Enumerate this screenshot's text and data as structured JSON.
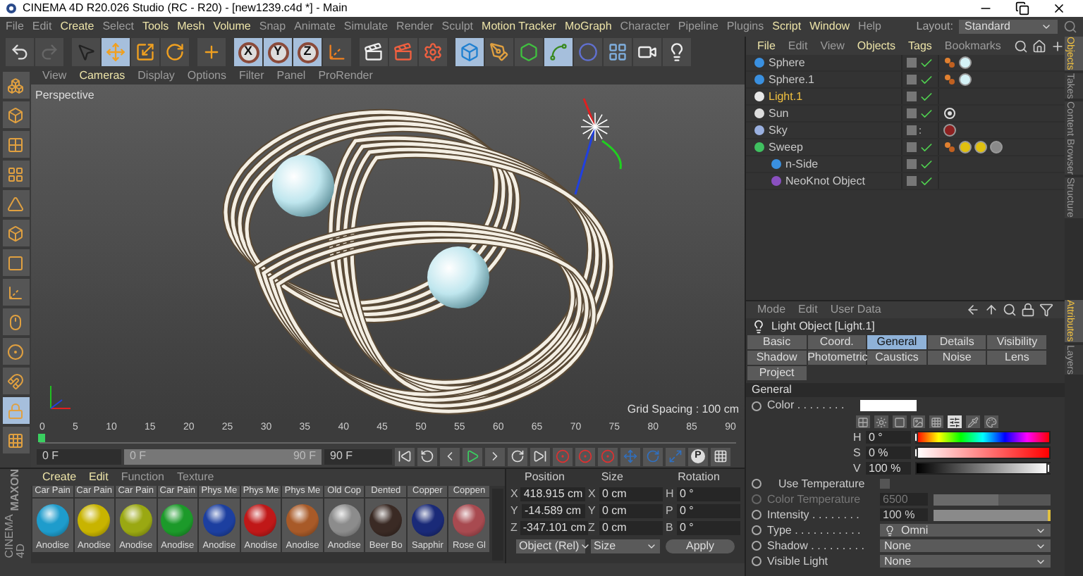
{
  "window": {
    "title": "CINEMA 4D R20.026 Studio (RC - R20) - [new1239.c4d *] - Main"
  },
  "menu": [
    {
      "label": "File",
      "highlight": false
    },
    {
      "label": "Edit",
      "highlight": false
    },
    {
      "label": "Create",
      "highlight": true
    },
    {
      "label": "Select",
      "highlight": false
    },
    {
      "label": "Tools",
      "highlight": true
    },
    {
      "label": "Mesh",
      "highlight": true
    },
    {
      "label": "Volume",
      "highlight": true
    },
    {
      "label": "Snap",
      "highlight": false
    },
    {
      "label": "Animate",
      "highlight": false
    },
    {
      "label": "Simulate",
      "highlight": false
    },
    {
      "label": "Render",
      "highlight": false
    },
    {
      "label": "Sculpt",
      "highlight": false
    },
    {
      "label": "Motion Tracker",
      "highlight": true
    },
    {
      "label": "MoGraph",
      "highlight": true
    },
    {
      "label": "Character",
      "highlight": false
    },
    {
      "label": "Pipeline",
      "highlight": false
    },
    {
      "label": "Plugins",
      "highlight": false
    },
    {
      "label": "Script",
      "highlight": true
    },
    {
      "label": "Window",
      "highlight": true
    },
    {
      "label": "Help",
      "highlight": false
    }
  ],
  "layout": {
    "label": "Layout:",
    "value": "Standard"
  },
  "toolbar": [
    {
      "kind": "undo",
      "active": false
    },
    {
      "kind": "redo",
      "active": false
    },
    {
      "kind": "separator"
    },
    {
      "kind": "select",
      "active": false
    },
    {
      "kind": "move",
      "active": true
    },
    {
      "kind": "scale",
      "active": false
    },
    {
      "kind": "rotate",
      "active": false
    },
    {
      "kind": "separator"
    },
    {
      "kind": "add",
      "active": false
    },
    {
      "kind": "separator"
    },
    {
      "kind": "axis",
      "label": "X",
      "active": true
    },
    {
      "kind": "axis",
      "label": "Y",
      "active": true
    },
    {
      "kind": "axis",
      "label": "Z",
      "active": true
    },
    {
      "kind": "coords",
      "active": false
    },
    {
      "kind": "separator"
    },
    {
      "kind": "render-view",
      "active": false
    },
    {
      "kind": "render",
      "active": false
    },
    {
      "kind": "render-settings",
      "active": false
    },
    {
      "kind": "separator"
    },
    {
      "kind": "cube",
      "active": true
    },
    {
      "kind": "pen",
      "active": false
    },
    {
      "kind": "subdivision",
      "active": false
    },
    {
      "kind": "sweep",
      "active": true
    },
    {
      "kind": "deformer",
      "active": false
    },
    {
      "kind": "floor",
      "active": false
    },
    {
      "kind": "camera",
      "active": false
    },
    {
      "kind": "light",
      "active": false
    }
  ],
  "tools": [
    {
      "kind": "convert",
      "active": false
    },
    {
      "kind": "model",
      "active": false
    },
    {
      "kind": "texture",
      "active": false
    },
    {
      "kind": "workplane",
      "active": false
    },
    {
      "kind": "points",
      "active": false
    },
    {
      "kind": "edges",
      "active": false
    },
    {
      "kind": "polygons",
      "active": false
    },
    {
      "kind": "axis",
      "active": false
    },
    {
      "kind": "tweak",
      "active": false
    },
    {
      "kind": "snap",
      "active": false
    },
    {
      "kind": "magnet",
      "active": false
    },
    {
      "kind": "lock",
      "active": true
    },
    {
      "kind": "planar",
      "active": false
    }
  ],
  "viewport": {
    "menu": [
      {
        "label": "View",
        "highlight": false
      },
      {
        "label": "Cameras",
        "highlight": true
      },
      {
        "label": "Display",
        "highlight": false
      },
      {
        "label": "Options",
        "highlight": false
      },
      {
        "label": "Filter",
        "highlight": false
      },
      {
        "label": "Panel",
        "highlight": false
      },
      {
        "label": "ProRender",
        "highlight": false
      }
    ],
    "camera": "Perspective",
    "grid_spacing": "Grid Spacing : 100 cm"
  },
  "timeline": {
    "ticks": [
      "0",
      "5",
      "10",
      "15",
      "20",
      "25",
      "30",
      "35",
      "40",
      "45",
      "50",
      "55",
      "60",
      "65",
      "70",
      "75",
      "80",
      "85",
      "90"
    ],
    "level": 0
  },
  "playback": {
    "start": "0 F",
    "range_start": "0 F",
    "range_end": "90 F",
    "level": 1,
    "end": "90 F",
    "buttons": [
      {
        "kind": "first"
      },
      {
        "kind": "prev-key"
      },
      {
        "kind": "prev-frame"
      },
      {
        "kind": "play"
      },
      {
        "kind": "next-frame"
      },
      {
        "kind": "next-key"
      },
      {
        "kind": "last"
      },
      {
        "kind": "record"
      },
      {
        "kind": "record"
      },
      {
        "kind": "record"
      },
      {
        "kind": "key-move"
      },
      {
        "kind": "key-rotate"
      },
      {
        "kind": "key-scale"
      },
      {
        "kind": "param",
        "label": "P"
      },
      {
        "kind": "grid"
      }
    ]
  },
  "logo": {
    "top": "MAXON",
    "bottom": "CINEMA 4D"
  },
  "materials": {
    "menu": [
      {
        "label": "Create",
        "highlight": true
      },
      {
        "label": "Edit",
        "highlight": true
      },
      {
        "label": "Function",
        "highlight": false
      },
      {
        "label": "Texture",
        "highlight": false
      }
    ],
    "upper_row_labels": [
      "Car Pain",
      "Car Pain",
      "Car Pain",
      "Car Pain",
      "Phys Me",
      "Phys Me",
      "Phys Me",
      "Old Cop",
      "Dented",
      "Copper",
      "Coppen"
    ],
    "items": [
      {
        "name": "Anodise",
        "color": "#1e9ccc"
      },
      {
        "name": "Anodise",
        "color": "#c8b400"
      },
      {
        "name": "Anodise",
        "color": "#9aa812"
      },
      {
        "name": "Anodise",
        "color": "#1c9a2a"
      },
      {
        "name": "Anodise",
        "color": "#1c3fa0"
      },
      {
        "name": "Anodise",
        "color": "#c01818"
      },
      {
        "name": "Anodise",
        "color": "#a85a28"
      },
      {
        "name": "Anodise",
        "color": "#8c8c8c"
      },
      {
        "name": "Beer Bo",
        "color": "#3a2a24"
      },
      {
        "name": "Sapphir",
        "color": "#1a2a78"
      },
      {
        "name": "Rose Gl",
        "color": "#a84a50"
      }
    ]
  },
  "coordinates": {
    "headers": [
      "Position",
      "Size",
      "Rotation"
    ],
    "rows": [
      [
        {
          "axis": "X",
          "value": "418.915 cm"
        },
        {
          "axis": "X",
          "value": "0 cm"
        },
        {
          "axis": "H",
          "value": "0 °"
        }
      ],
      [
        {
          "axis": "Y",
          "value": "-14.589 cm"
        },
        {
          "axis": "Y",
          "value": "0 cm"
        },
        {
          "axis": "P",
          "value": "0 °"
        }
      ],
      [
        {
          "axis": "Z",
          "value": "-347.101 cm"
        },
        {
          "axis": "Z",
          "value": "0 cm"
        },
        {
          "axis": "B",
          "value": "0 °"
        }
      ]
    ],
    "mode": "Object (Rel)",
    "size_mode": "Size",
    "apply": "Apply"
  },
  "objects": {
    "menu": [
      {
        "label": "File",
        "highlight": true
      },
      {
        "label": "Edit",
        "highlight": false
      },
      {
        "label": "View",
        "highlight": false
      },
      {
        "label": "Objects",
        "highlight": true
      },
      {
        "label": "Tags",
        "highlight": true
      },
      {
        "label": "Bookmarks",
        "highlight": false
      }
    ],
    "items": [
      {
        "name": "Sphere",
        "kind": "sphere",
        "selected": false,
        "enabled": true,
        "tags": [
          {
            "kind": "phong"
          },
          {
            "kind": "material",
            "color": "#d4f2f6"
          }
        ]
      },
      {
        "name": "Sphere.1",
        "kind": "sphere",
        "selected": false,
        "enabled": true,
        "tags": [
          {
            "kind": "phong"
          },
          {
            "kind": "material",
            "color": "#d4f2f6"
          }
        ]
      },
      {
        "name": "Light.1",
        "kind": "light",
        "selected": true,
        "enabled": true
      },
      {
        "name": "Sun",
        "kind": "sun",
        "selected": false,
        "enabled": true,
        "tags": [
          {
            "kind": "target"
          }
        ]
      },
      {
        "name": "Sky",
        "kind": "sky",
        "selected": false,
        "enabled": false,
        "tags": [
          {
            "kind": "material",
            "color": "#8c2020"
          }
        ]
      },
      {
        "name": "Sweep",
        "kind": "sweep",
        "selected": false,
        "enabled": true,
        "tags": [
          {
            "kind": "phong"
          },
          {
            "kind": "material",
            "color": "#e0c010"
          },
          {
            "kind": "material",
            "color": "#e0c010"
          },
          {
            "kind": "material",
            "color": "#8a8a8a"
          }
        ],
        "children": [
          {
            "name": "n-Side",
            "kind": "spline",
            "selected": false,
            "enabled": true
          },
          {
            "name": "NeoKnot Object",
            "kind": "knot",
            "selected": false,
            "enabled": true
          }
        ]
      }
    ]
  },
  "side_tabs_top": [
    {
      "label": "Objects",
      "selected": true
    },
    {
      "label": "Takes",
      "selected": false
    },
    {
      "label": "Content Browser",
      "selected": false
    },
    {
      "label": "Structure",
      "selected": false
    }
  ],
  "attributes": {
    "menu": [
      {
        "label": "Mode",
        "highlight": false
      },
      {
        "label": "Edit",
        "highlight": false
      },
      {
        "label": "User Data",
        "highlight": false
      }
    ],
    "title": "Light Object [Light.1]",
    "tabs": [
      {
        "label": "Basic",
        "selected": false
      },
      {
        "label": "Coord.",
        "selected": false
      },
      {
        "label": "General",
        "selected": true
      },
      {
        "label": "Details",
        "selected": false
      },
      {
        "label": "Visibility",
        "selected": false
      },
      {
        "label": "Shadow",
        "selected": false
      },
      {
        "label": "Photometric",
        "selected": false
      },
      {
        "label": "Caustics",
        "selected": false
      },
      {
        "label": "Noise",
        "selected": false
      },
      {
        "label": "Lens",
        "selected": false
      },
      {
        "label": "Project",
        "selected": false
      }
    ],
    "section": "General",
    "color": {
      "label": "Color . . . . . . . .",
      "color": "#ffffff",
      "modes": [
        {
          "selected": false
        },
        {
          "selected": false
        },
        {
          "selected": false
        },
        {
          "selected": false
        },
        {
          "selected": false
        },
        {
          "selected": true
        },
        {
          "selected": false
        },
        {
          "selected": false
        }
      ],
      "channels": [
        {
          "kind": "hue",
          "label": "H",
          "value": "0 °",
          "level": 0
        },
        {
          "kind": "saturation",
          "label": "S",
          "value": "0 %",
          "level": 0
        },
        {
          "kind": "value",
          "label": "V",
          "value": "100 %",
          "level": 1
        }
      ]
    },
    "fields": [
      {
        "kind": "checkbox",
        "label": "Use Temperature",
        "checked": false,
        "disabled": false
      },
      {
        "kind": "slider",
        "label": "Color Temperature",
        "value": "6500",
        "level": 0.55,
        "disabled": true
      },
      {
        "kind": "slider",
        "label": "Intensity . . . . . . . .",
        "value": "100 %",
        "level": 1,
        "disabled": false
      },
      {
        "kind": "dropdown",
        "label": "Type . . . . . . . . . . .",
        "value": "Omni",
        "icon": true,
        "disabled": false
      },
      {
        "kind": "dropdown",
        "label": "Shadow . . . . . . . . .",
        "value": "None",
        "icon": false,
        "disabled": false
      },
      {
        "kind": "dropdown",
        "label": "Visible Light",
        "value": "None",
        "icon": false,
        "disabled": false
      }
    ]
  },
  "side_tabs_bottom": [
    {
      "label": "Attributes",
      "selected": true
    },
    {
      "label": "Layers",
      "selected": false
    }
  ]
}
